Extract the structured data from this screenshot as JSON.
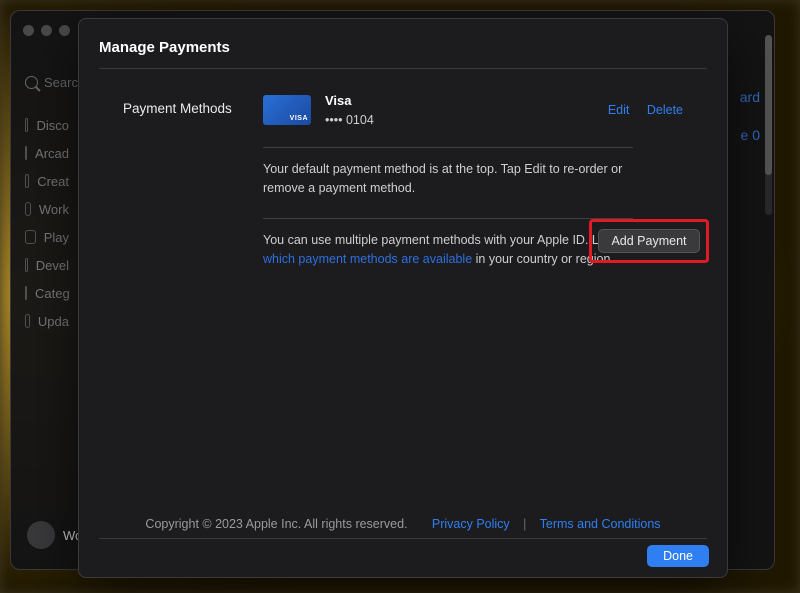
{
  "window": {
    "search_placeholder": "Search"
  },
  "sidebar": {
    "items": [
      {
        "label": "Disco"
      },
      {
        "label": "Arcad"
      },
      {
        "label": "Creat"
      },
      {
        "label": "Work"
      },
      {
        "label": "Play"
      },
      {
        "label": "Devel"
      },
      {
        "label": "Categ"
      },
      {
        "label": "Upda"
      }
    ],
    "dock_label": "Wo"
  },
  "bg_right": {
    "line1": "ard",
    "line2": "e 0"
  },
  "modal": {
    "title": "Manage Payments",
    "section_label": "Payment Methods",
    "card": {
      "brand": "Visa",
      "masked": "•••• 0104"
    },
    "edit": "Edit",
    "delete": "Delete",
    "help1": "Your default payment method is at the top. Tap Edit to re-order or remove a payment method.",
    "help2_a": "You can use multiple payment methods with your Apple ID. Learn ",
    "help2_link": "which payment methods are available",
    "help2_b": " in your country or region.",
    "add_payment": "Add Payment",
    "footer_copyright": "Copyright © 2023 Apple Inc. All rights reserved.",
    "footer_privacy": "Privacy Policy",
    "footer_terms": "Terms and Conditions",
    "done": "Done"
  }
}
